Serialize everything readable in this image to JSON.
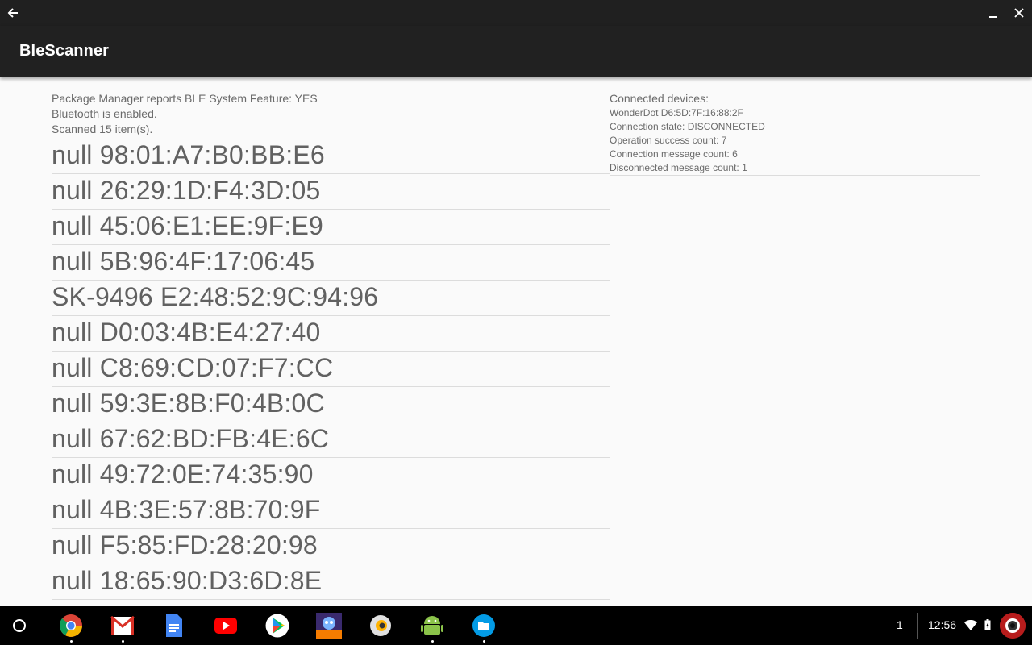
{
  "window": {
    "back_icon": "arrow-left-icon",
    "minimize_icon": "minimize-icon",
    "close_icon": "close-icon"
  },
  "appbar": {
    "title": "BleScanner"
  },
  "status": {
    "line1": "Package Manager reports BLE System Feature: YES",
    "line2": "Bluetooth is enabled.",
    "line3": "Scanned 15 item(s)."
  },
  "devices": [
    "null 98:01:A7:B0:BB:E6",
    "null 26:29:1D:F4:3D:05",
    "null 45:06:E1:EE:9F:E9",
    "null 5B:96:4F:17:06:45",
    "SK-9496 E2:48:52:9C:94:96",
    "null D0:03:4B:E4:27:40",
    "null C8:69:CD:07:F7:CC",
    "null 59:3E:8B:F0:4B:0C",
    "null 67:62:BD:FB:4E:6C",
    "null 49:72:0E:74:35:90",
    "null 4B:3E:57:8B:70:9F",
    "null F5:85:FD:28:20:98",
    "null 18:65:90:D3:6D:8E"
  ],
  "connected": {
    "heading": "Connected devices:",
    "device": "WonderDot D6:5D:7F:16:88:2F",
    "state": "Connection state: DISCONNECTED",
    "success": "Operation success count: 7",
    "messages": "Connection message count: 6",
    "disconnected": "Disconnected message count: 1"
  },
  "shelf": {
    "apps": [
      "chrome-icon",
      "gmail-icon",
      "docs-icon",
      "youtube-icon",
      "play-store-icon",
      "game-icon",
      "camera-app-icon",
      "android-icon",
      "files-icon"
    ],
    "badge": "1",
    "time": "12:56"
  },
  "colors": {
    "appbar": "#212121",
    "titlebar": "#202020",
    "background": "#fafafa",
    "text": "#616161"
  }
}
